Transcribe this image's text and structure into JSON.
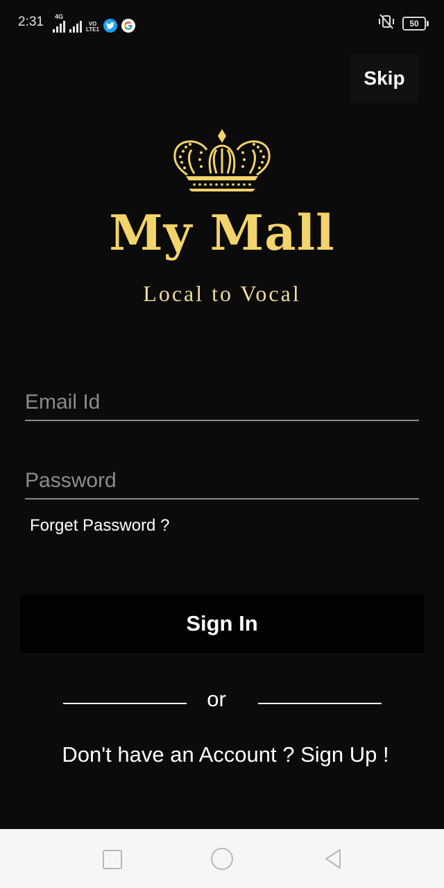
{
  "status_bar": {
    "time": "2:31",
    "network_label": "4G",
    "volte_label_1": "VO",
    "volte_label_2": "LTE",
    "sim_index": "1",
    "battery_level": "50"
  },
  "header": {
    "skip_label": "Skip"
  },
  "brand": {
    "name": "My Mall",
    "tagline": "Local to Vocal",
    "accent_color": "#f3d36b"
  },
  "form": {
    "email_placeholder": "Email Id",
    "email_value": "",
    "password_placeholder": "Password",
    "password_value": "",
    "forgot_label": "Forget Password ?",
    "signin_label": "Sign In",
    "or_label": "or",
    "signup_label": "Don't have an Account ? Sign Up !"
  },
  "icons": {
    "twitter": "twitter-icon",
    "google": "google-icon",
    "silent": "vibrate-off-icon",
    "battery": "battery-icon",
    "crown": "crown-logo",
    "nav_recent": "square-icon",
    "nav_home": "circle-icon",
    "nav_back": "triangle-back-icon"
  }
}
